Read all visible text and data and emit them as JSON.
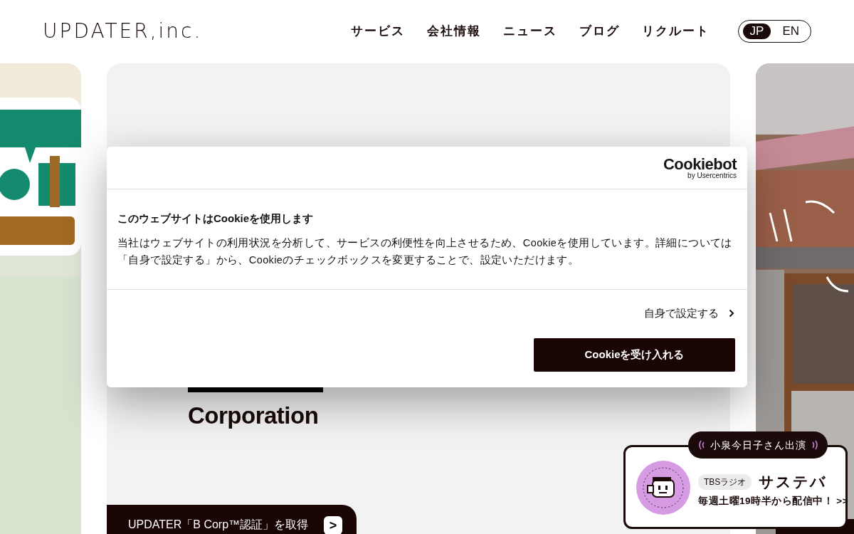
{
  "header": {
    "logo": "UPDATER,inc.",
    "nav": [
      "サービス",
      "会社情報",
      "ニュース",
      "ブログ",
      "リクルート"
    ],
    "languages": [
      {
        "label": "JP",
        "selected": true
      },
      {
        "label": "EN",
        "selected": false
      }
    ]
  },
  "slides": {
    "center_title": "Corporation",
    "news_caption": "UPDATER「B Corp™認証」を取得",
    "news_arrow": ">"
  },
  "cookie_dialog": {
    "brand": "Cookiebot",
    "brand_sub": "by Usercentrics",
    "title": "このウェブサイトはCookieを使用します",
    "body": "当社はウェブサイトの利用状況を分析して、サービスの利便性を向上させるため、Cookieを使用しています。詳細については「自身で設定する」から、Cookieのチェックボックスを変更することで、設定いただけます。",
    "settings_link": "自身で設定する",
    "accept_button": "Cookieを受け入れる"
  },
  "radio_banner": {
    "tag": "小泉今日子さん出演",
    "station": "TBSラジオ",
    "program": "サステバ",
    "schedule": "毎週土曜19時半から配信中！ >>"
  }
}
